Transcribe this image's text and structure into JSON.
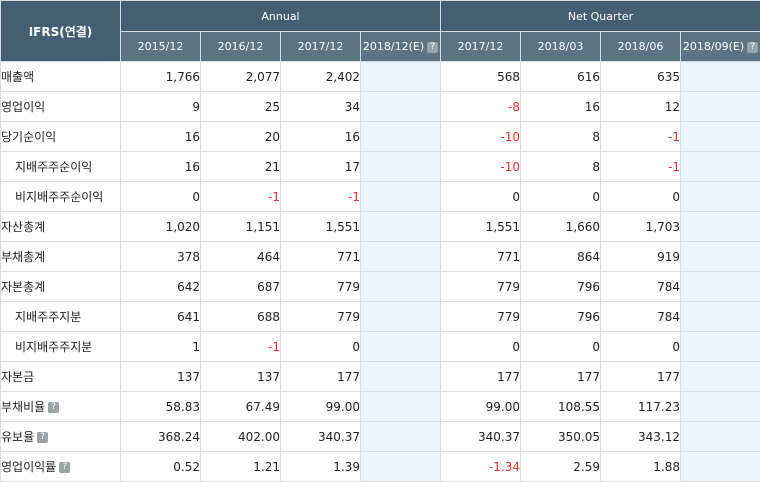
{
  "header": {
    "corner_label": "IFRS(연결)",
    "groups": [
      {
        "label": "Annual",
        "span": 4
      },
      {
        "label": "Net Quarter",
        "span": 4
      }
    ],
    "periods": [
      {
        "label": "2015/12",
        "help": false
      },
      {
        "label": "2016/12",
        "help": false
      },
      {
        "label": "2017/12",
        "help": false
      },
      {
        "label": "2018/12(E)",
        "help": true
      },
      {
        "label": "2017/12",
        "help": false
      },
      {
        "label": "2018/03",
        "help": false
      },
      {
        "label": "2018/06",
        "help": false
      },
      {
        "label": "2018/09(E)",
        "help": true
      }
    ],
    "help_icon": "question-mark-icon"
  },
  "rows": [
    {
      "label": "매출액",
      "sub": false,
      "help": false,
      "values": [
        "1,766",
        "2,077",
        "2,402",
        "",
        "568",
        "616",
        "635",
        ""
      ]
    },
    {
      "label": "영업이익",
      "sub": false,
      "help": false,
      "values": [
        "9",
        "25",
        "34",
        "",
        "-8",
        "16",
        "12",
        ""
      ]
    },
    {
      "label": "당기순이익",
      "sub": false,
      "help": false,
      "values": [
        "16",
        "20",
        "16",
        "",
        "-10",
        "8",
        "-1",
        ""
      ]
    },
    {
      "label": "지배주주순이익",
      "sub": true,
      "help": false,
      "values": [
        "16",
        "21",
        "17",
        "",
        "-10",
        "8",
        "-1",
        ""
      ]
    },
    {
      "label": "비지배주주순이익",
      "sub": true,
      "help": false,
      "values": [
        "0",
        "-1",
        "-1",
        "",
        "0",
        "0",
        "0",
        ""
      ]
    },
    {
      "label": "자산총계",
      "sub": false,
      "help": false,
      "values": [
        "1,020",
        "1,151",
        "1,551",
        "",
        "1,551",
        "1,660",
        "1,703",
        ""
      ]
    },
    {
      "label": "부채총계",
      "sub": false,
      "help": false,
      "values": [
        "378",
        "464",
        "771",
        "",
        "771",
        "864",
        "919",
        ""
      ]
    },
    {
      "label": "자본총계",
      "sub": false,
      "help": false,
      "values": [
        "642",
        "687",
        "779",
        "",
        "779",
        "796",
        "784",
        ""
      ]
    },
    {
      "label": "지배주주지분",
      "sub": true,
      "help": false,
      "values": [
        "641",
        "688",
        "779",
        "",
        "779",
        "796",
        "784",
        ""
      ]
    },
    {
      "label": "비지배주주지분",
      "sub": true,
      "help": false,
      "values": [
        "1",
        "-1",
        "0",
        "",
        "0",
        "0",
        "0",
        ""
      ]
    },
    {
      "label": "자본금",
      "sub": false,
      "help": false,
      "values": [
        "137",
        "137",
        "177",
        "",
        "177",
        "177",
        "177",
        ""
      ]
    },
    {
      "label": "부채비율",
      "sub": false,
      "help": true,
      "values": [
        "58.83",
        "67.49",
        "99.00",
        "",
        "99.00",
        "108.55",
        "117.23",
        ""
      ]
    },
    {
      "label": "유보율",
      "sub": false,
      "help": true,
      "values": [
        "368.24",
        "402.00",
        "340.37",
        "",
        "340.37",
        "350.05",
        "343.12",
        ""
      ]
    },
    {
      "label": "영업이익률",
      "sub": false,
      "help": true,
      "values": [
        "0.52",
        "1.21",
        "1.39",
        "",
        "-1.34",
        "2.59",
        "1.88",
        ""
      ]
    }
  ],
  "colors": {
    "header_bg": "#455f72",
    "subheader_bg": "#5c7384",
    "estimate_bg": "#e9f5fb",
    "negative_text": "#e8302e"
  }
}
